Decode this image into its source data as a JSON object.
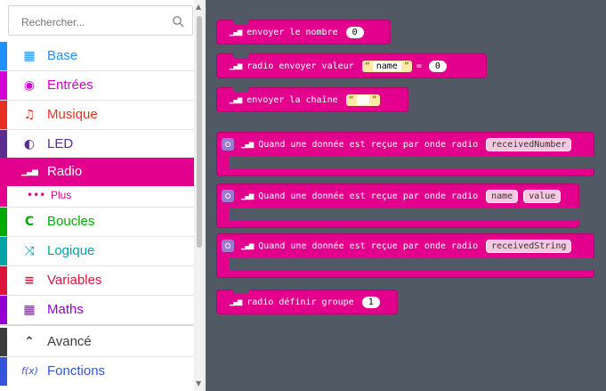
{
  "search": {
    "placeholder": "Rechercher..."
  },
  "sidebar": {
    "items": [
      {
        "label": "Base",
        "icon": "grid-icon",
        "glyph": "▦",
        "color": "#1e90ff"
      },
      {
        "label": "Entrées",
        "icon": "radio-button-icon",
        "glyph": "◉",
        "color": "#d400d4"
      },
      {
        "label": "Musique",
        "icon": "headphones-icon",
        "glyph": "♫",
        "color": "#e63022"
      },
      {
        "label": "LED",
        "icon": "toggle-icon",
        "glyph": "◐",
        "color": "#5c2d91"
      },
      {
        "label": "Radio",
        "icon": "signal-icon",
        "glyph": "▁▃▅",
        "color": "#e3008c"
      },
      {
        "label": "Plus",
        "icon": "more-icon",
        "glyph": "•••",
        "color": "#e3008c"
      },
      {
        "label": "Boucles",
        "icon": "loop-icon",
        "glyph": "C",
        "color": "#00aa00"
      },
      {
        "label": "Logique",
        "icon": "shuffle-icon",
        "glyph": "⤨",
        "color": "#00a4a6"
      },
      {
        "label": "Variables",
        "icon": "list-icon",
        "glyph": "≡",
        "color": "#dc143c"
      },
      {
        "label": "Maths",
        "icon": "calculator-icon",
        "glyph": "▦",
        "color": "#9400d3"
      },
      {
        "label": "Avancé",
        "icon": "chevron-up-icon",
        "glyph": "⌃",
        "color": "#3c3c3c"
      },
      {
        "label": "Fonctions",
        "icon": "function-icon",
        "glyph": "f(x)",
        "color": "#3455db"
      }
    ]
  },
  "blocks": {
    "send_number": {
      "label": "envoyer le nombre",
      "value": "0"
    },
    "send_value": {
      "label": "radio envoyer valeur",
      "name": "name",
      "eq": "=",
      "value": "0"
    },
    "send_string": {
      "label": "envoyer la chaîne",
      "value": ""
    },
    "on_number": {
      "label": "Quand une donnée est reçue par onde radio",
      "var": "receivedNumber"
    },
    "on_value": {
      "label": "Quand une donnée est reçue par onde radio",
      "var1": "name",
      "var2": "value"
    },
    "on_string": {
      "label": "Quand une donnée est reçue par onde radio",
      "var": "receivedString"
    },
    "set_group": {
      "label": "radio définir groupe",
      "value": "1"
    }
  },
  "colors": {
    "radio": "#e3008c",
    "workspace": "#515a64"
  }
}
